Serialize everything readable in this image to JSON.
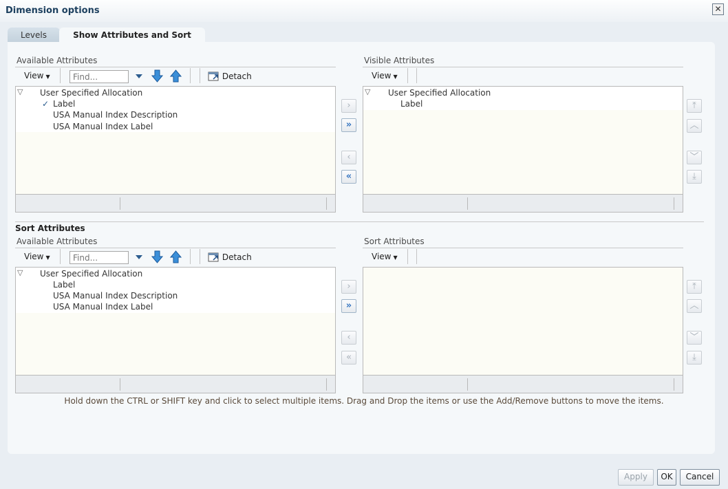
{
  "dialog": {
    "title": "Dimension options",
    "close_glyph": "✕"
  },
  "tabs": [
    {
      "label": "Levels"
    },
    {
      "label": "Show Attributes and Sort"
    }
  ],
  "show_section": {
    "available_label": "Available Attributes",
    "visible_label": "Visible Attributes",
    "view_label": "View",
    "find_placeholder": "Find...",
    "detach_label": "Detach",
    "available_items": [
      {
        "label": "User Specified Allocation"
      },
      {
        "label": "Label",
        "checked": true
      },
      {
        "label": "USA Manual Index Description"
      },
      {
        "label": "USA Manual Index Label"
      }
    ],
    "visible_items": [
      {
        "label": "User Specified Allocation"
      },
      {
        "label": "Label"
      }
    ]
  },
  "sort_section": {
    "title": "Sort Attributes",
    "available_label": "Available Attributes",
    "sort_label": "Sort Attributes",
    "view_label": "View",
    "find_placeholder": "Find...",
    "detach_label": "Detach",
    "available_items": [
      {
        "label": "User Specified Allocation"
      },
      {
        "label": "Label"
      },
      {
        "label": "USA Manual Index Description"
      },
      {
        "label": "USA Manual Index Label"
      }
    ]
  },
  "glyphs": {
    "move": "›",
    "move_all": "»",
    "remove": "‹",
    "remove_all": "«",
    "top": "⤒",
    "up": "︿",
    "down": "﹀",
    "bottom": "⤓",
    "check": "✓",
    "expand": "▽",
    "caret": "▼"
  },
  "hint": "Hold down the CTRL or SHIFT key and click to select multiple items. Drag and Drop the items or use the Add/Remove buttons to move the items.",
  "footer": {
    "apply": "Apply",
    "ok": "OK",
    "cancel": "Cancel"
  },
  "colors": {
    "accent": "#3a78c2",
    "title": "#1c3f5e",
    "list_bg": "#fcfcf5"
  }
}
